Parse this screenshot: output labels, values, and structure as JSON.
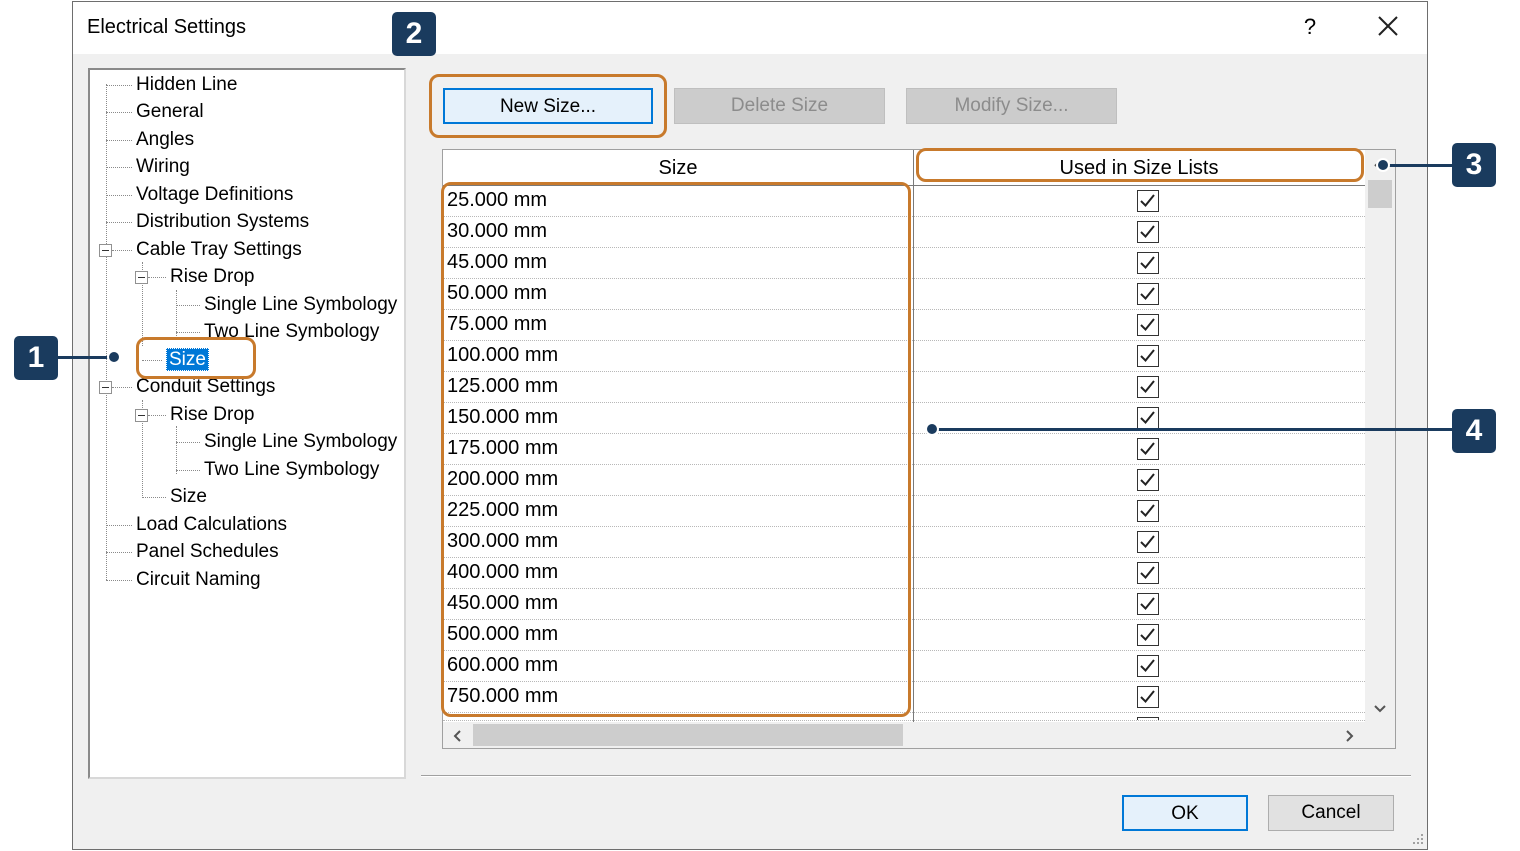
{
  "dialog": {
    "title": "Electrical Settings",
    "help": "?"
  },
  "tree": {
    "items": [
      {
        "label": "Hidden Line"
      },
      {
        "label": "General"
      },
      {
        "label": "Angles"
      },
      {
        "label": "Wiring"
      },
      {
        "label": "Voltage Definitions"
      },
      {
        "label": "Distribution Systems"
      },
      {
        "label": "Cable Tray Settings"
      },
      {
        "label": "Rise Drop"
      },
      {
        "label": "Single Line Symbology"
      },
      {
        "label": "Two Line Symbology"
      },
      {
        "label": "Size"
      },
      {
        "label": "Conduit Settings"
      },
      {
        "label": "Rise Drop"
      },
      {
        "label": "Single Line Symbology"
      },
      {
        "label": "Two Line Symbology"
      },
      {
        "label": "Size"
      },
      {
        "label": "Load Calculations"
      },
      {
        "label": "Panel Schedules"
      },
      {
        "label": "Circuit Naming"
      }
    ]
  },
  "toolbar": {
    "new_size": "New Size...",
    "delete_size": "Delete Size",
    "modify_size": "Modify Size..."
  },
  "grid": {
    "columns": [
      "Size",
      "Used in Size Lists"
    ],
    "rows": [
      {
        "size": "25.000 mm",
        "used": true
      },
      {
        "size": "30.000 mm",
        "used": true
      },
      {
        "size": "45.000 mm",
        "used": true
      },
      {
        "size": "50.000 mm",
        "used": true
      },
      {
        "size": "75.000 mm",
        "used": true
      },
      {
        "size": "100.000 mm",
        "used": true
      },
      {
        "size": "125.000 mm",
        "used": true
      },
      {
        "size": "150.000 mm",
        "used": true
      },
      {
        "size": "175.000 mm",
        "used": true
      },
      {
        "size": "200.000 mm",
        "used": true
      },
      {
        "size": "225.000 mm",
        "used": true
      },
      {
        "size": "300.000 mm",
        "used": true
      },
      {
        "size": "400.000 mm",
        "used": true
      },
      {
        "size": "450.000 mm",
        "used": true
      },
      {
        "size": "500.000 mm",
        "used": true
      },
      {
        "size": "600.000 mm",
        "used": true
      },
      {
        "size": "750.000 mm",
        "used": true
      }
    ]
  },
  "footer": {
    "ok": "OK",
    "cancel": "Cancel"
  },
  "callouts": [
    "1",
    "2",
    "3",
    "4"
  ],
  "colors": {
    "callout": "#1a3b5e",
    "highlight": "#c87a2c",
    "selection": "#0078d7"
  }
}
